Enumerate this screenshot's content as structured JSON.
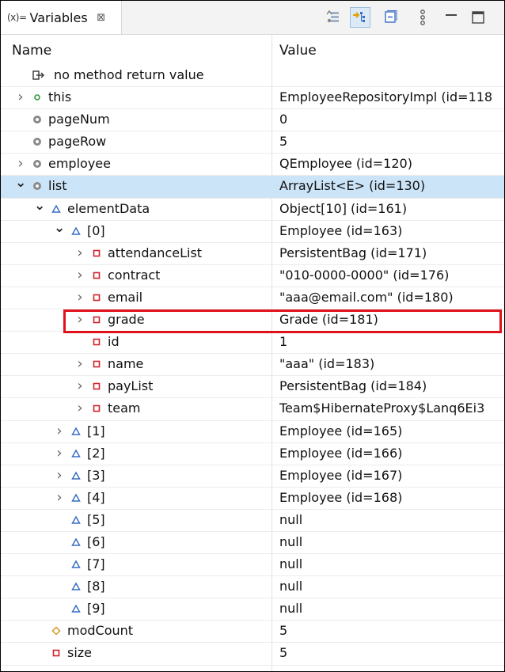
{
  "tab": {
    "icon": "(x)=",
    "title": "Variables",
    "close": "⊠"
  },
  "toolbar": {
    "buttons": [
      {
        "name": "show-type-names-icon",
        "pressed": false
      },
      {
        "name": "show-logical-structure-icon",
        "pressed": true
      },
      {
        "name": "collapse-all-icon",
        "pressed": false
      },
      {
        "name": "view-menu-icon",
        "pressed": false
      },
      {
        "name": "minimize-icon",
        "pressed": false
      },
      {
        "name": "maximize-icon",
        "pressed": false
      }
    ]
  },
  "columns": {
    "name": "Name",
    "value": "Value"
  },
  "rows": [
    {
      "name": "no method return value",
      "value": "",
      "icon": "return",
      "twisty": "none",
      "depth": 0
    },
    {
      "name": "this",
      "value": "EmployeeRepositoryImpl  (id=118",
      "icon": "green",
      "twisty": "closed",
      "depth": 0
    },
    {
      "name": "pageNum",
      "value": "0",
      "icon": "gray",
      "twisty": "none",
      "depth": 0
    },
    {
      "name": "pageRow",
      "value": "5",
      "icon": "gray",
      "twisty": "none",
      "depth": 0
    },
    {
      "name": "employee",
      "value": "QEmployee  (id=120)",
      "icon": "gray",
      "twisty": "closed",
      "depth": 0
    },
    {
      "name": "list",
      "value": "ArrayList<E>  (id=130)",
      "icon": "gray",
      "twisty": "open",
      "depth": 0,
      "selected": true
    },
    {
      "name": "elementData",
      "value": "Object[10]  (id=161)",
      "icon": "triangle",
      "twisty": "open",
      "depth": 1
    },
    {
      "name": "[0]",
      "value": "Employee  (id=163)",
      "icon": "triangle",
      "twisty": "open",
      "depth": 2
    },
    {
      "name": "attendanceList",
      "value": "PersistentBag  (id=171)",
      "icon": "square",
      "twisty": "closed",
      "depth": 3
    },
    {
      "name": "contract",
      "value": "\"010-0000-0000\" (id=176)",
      "icon": "square",
      "twisty": "closed",
      "depth": 3
    },
    {
      "name": "email",
      "value": "\"aaa@email.com\" (id=180)",
      "icon": "square",
      "twisty": "closed",
      "depth": 3
    },
    {
      "name": "grade",
      "value": "Grade  (id=181)",
      "icon": "square",
      "twisty": "closed",
      "depth": 3
    },
    {
      "name": "id",
      "value": "1",
      "icon": "square",
      "twisty": "none",
      "depth": 3
    },
    {
      "name": "name",
      "value": "\"aaa\" (id=183)",
      "icon": "square",
      "twisty": "closed",
      "depth": 3
    },
    {
      "name": "payList",
      "value": "PersistentBag  (id=184)",
      "icon": "square",
      "twisty": "closed",
      "depth": 3
    },
    {
      "name": "team",
      "value": "Team$HibernateProxy$Lanq6Ei3",
      "icon": "square",
      "twisty": "closed",
      "depth": 3
    },
    {
      "name": "[1]",
      "value": "Employee  (id=165)",
      "icon": "triangle",
      "twisty": "closed",
      "depth": 2
    },
    {
      "name": "[2]",
      "value": "Employee  (id=166)",
      "icon": "triangle",
      "twisty": "closed",
      "depth": 2
    },
    {
      "name": "[3]",
      "value": "Employee  (id=167)",
      "icon": "triangle",
      "twisty": "closed",
      "depth": 2
    },
    {
      "name": "[4]",
      "value": "Employee  (id=168)",
      "icon": "triangle",
      "twisty": "closed",
      "depth": 2
    },
    {
      "name": "[5]",
      "value": "null",
      "icon": "triangle",
      "twisty": "none",
      "depth": 2
    },
    {
      "name": "[6]",
      "value": "null",
      "icon": "triangle",
      "twisty": "none",
      "depth": 2
    },
    {
      "name": "[7]",
      "value": "null",
      "icon": "triangle",
      "twisty": "none",
      "depth": 2
    },
    {
      "name": "[8]",
      "value": "null",
      "icon": "triangle",
      "twisty": "none",
      "depth": 2
    },
    {
      "name": "[9]",
      "value": "null",
      "icon": "triangle",
      "twisty": "none",
      "depth": 2
    },
    {
      "name": "modCount",
      "value": "5",
      "icon": "diamond",
      "twisty": "none",
      "depth": 1
    },
    {
      "name": "size",
      "value": "5",
      "icon": "square",
      "twisty": "none",
      "depth": 1
    }
  ],
  "colors": {
    "selection": "#cce4f7",
    "highlight_border": "#e0111b",
    "private_field": "#d0222b",
    "protected_field": "#d39a22",
    "package_field": "#3a6fc4",
    "public_field": "#2e9a3a",
    "local_var": "#8a8a8a"
  }
}
